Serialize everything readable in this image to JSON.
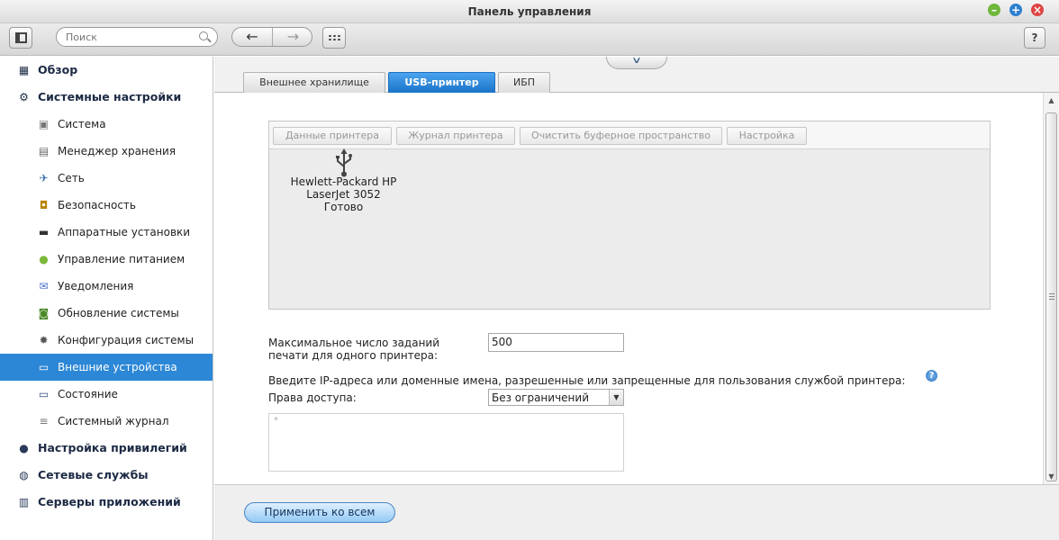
{
  "window": {
    "title": "Панель управления",
    "controls": {
      "minimize": "–",
      "maximize": "+",
      "close": "×"
    }
  },
  "toolbar": {
    "search_placeholder": "Поиск",
    "back_label": "←",
    "forward_label": "→",
    "help_label": "?"
  },
  "sidebar": {
    "items": [
      {
        "label": "Обзор",
        "level": "top",
        "icon": "grid-icon"
      },
      {
        "label": "Системные настройки",
        "level": "top",
        "icon": "gear-icon"
      },
      {
        "label": "Система",
        "level": "sub",
        "icon": "system-icon"
      },
      {
        "label": "Менеджер хранения",
        "level": "sub",
        "icon": "storage-icon"
      },
      {
        "label": "Сеть",
        "level": "sub",
        "icon": "network-icon"
      },
      {
        "label": "Безопасность",
        "level": "sub",
        "icon": "lock-icon"
      },
      {
        "label": "Аппаратные установки",
        "level": "sub",
        "icon": "hardware-icon"
      },
      {
        "label": "Управление питанием",
        "level": "sub",
        "icon": "power-bulb-icon"
      },
      {
        "label": "Уведомления",
        "level": "sub",
        "icon": "notification-icon"
      },
      {
        "label": "Обновление системы",
        "level": "sub",
        "icon": "update-icon"
      },
      {
        "label": "Конфигурация системы",
        "level": "sub",
        "icon": "config-icon"
      },
      {
        "label": "Внешние устройства",
        "level": "sub",
        "icon": "external-device-icon",
        "active": true
      },
      {
        "label": "Состояние",
        "level": "sub",
        "icon": "monitor-icon"
      },
      {
        "label": "Системный журнал",
        "level": "sub",
        "icon": "log-icon"
      },
      {
        "label": "Настройка привилегий",
        "level": "top",
        "icon": "user-icon"
      },
      {
        "label": "Сетевые службы",
        "level": "top",
        "icon": "globe-icon"
      },
      {
        "label": "Серверы приложений",
        "level": "top",
        "icon": "app-server-icon"
      }
    ]
  },
  "tabs": [
    {
      "label": "Внешнее хранилище",
      "active": false
    },
    {
      "label": "USB-принтер",
      "active": true
    },
    {
      "label": "ИБП",
      "active": false
    }
  ],
  "printer_panel": {
    "buttons": [
      "Данные принтера",
      "Журнал принтера",
      "Очистить буферное пространство",
      "Настройка"
    ],
    "printer": {
      "line1": "Hewlett-Packard HP",
      "line2": "LaserJet 3052",
      "status": "Готово"
    }
  },
  "form": {
    "max_jobs_label_line1": "Максимальное число заданий",
    "max_jobs_label_line2": "печати для одного принтера:",
    "max_jobs_value": "500",
    "ip_label": "Введите IP-адреса или доменные имена, разрешенные или запрещенные для пользования службой принтера:",
    "access_label": "Права доступа:",
    "access_value": "Без ограничений",
    "textarea_placeholder": "*"
  },
  "footer": {
    "apply_label": "Применить ко всем"
  },
  "colors": {
    "accent": "#2c87d6",
    "tab_active": "#1a73c8"
  }
}
